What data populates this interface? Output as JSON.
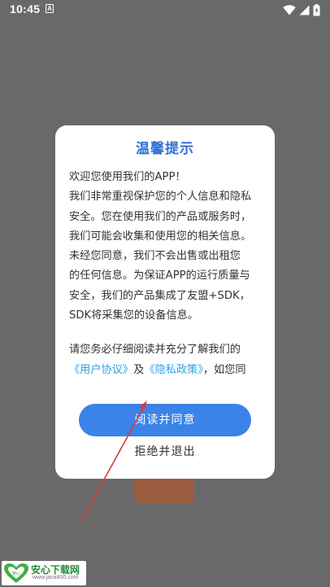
{
  "status_bar": {
    "time": "10:45",
    "notification_icon": "A"
  },
  "dialog": {
    "title": "温馨提示",
    "para1_lines": [
      "欢迎您使用我们的APP！",
      "我们非常重视保护您的个人信息和隐私",
      "安全。您在使用我们的产品或服务时，",
      "我们可能会收集和使用您的相关信息。",
      "未经您同意，我们不会出售或出租您",
      "的任何信息。为保证APP的运行质量与",
      "安全，我们的产品集成了友盟+SDK，",
      "SDK将采集您的设备信息。"
    ],
    "para2_line": "请您务必仔细阅读并充分了解我们的",
    "link_user_agreement": "《用户协议》",
    "and_text": "及",
    "link_privacy_policy": "《隐私政策》",
    "tail_text": "，如您同",
    "agree_label": "阅读并同意",
    "reject_label": "拒绝并退出"
  },
  "watermark": {
    "name": "安心下载网",
    "url": "www.java800.com",
    "logo_text": "安心"
  },
  "colors": {
    "overlay_background": "#696969",
    "title": "#2f6fd8",
    "primary_button": "#3a83e8",
    "link": "#2aa0e6",
    "arrow": "#d63a3a"
  },
  "icons": [
    "wifi-icon",
    "cellular-signal-icon",
    "battery-charging-icon",
    "notification-icon"
  ]
}
